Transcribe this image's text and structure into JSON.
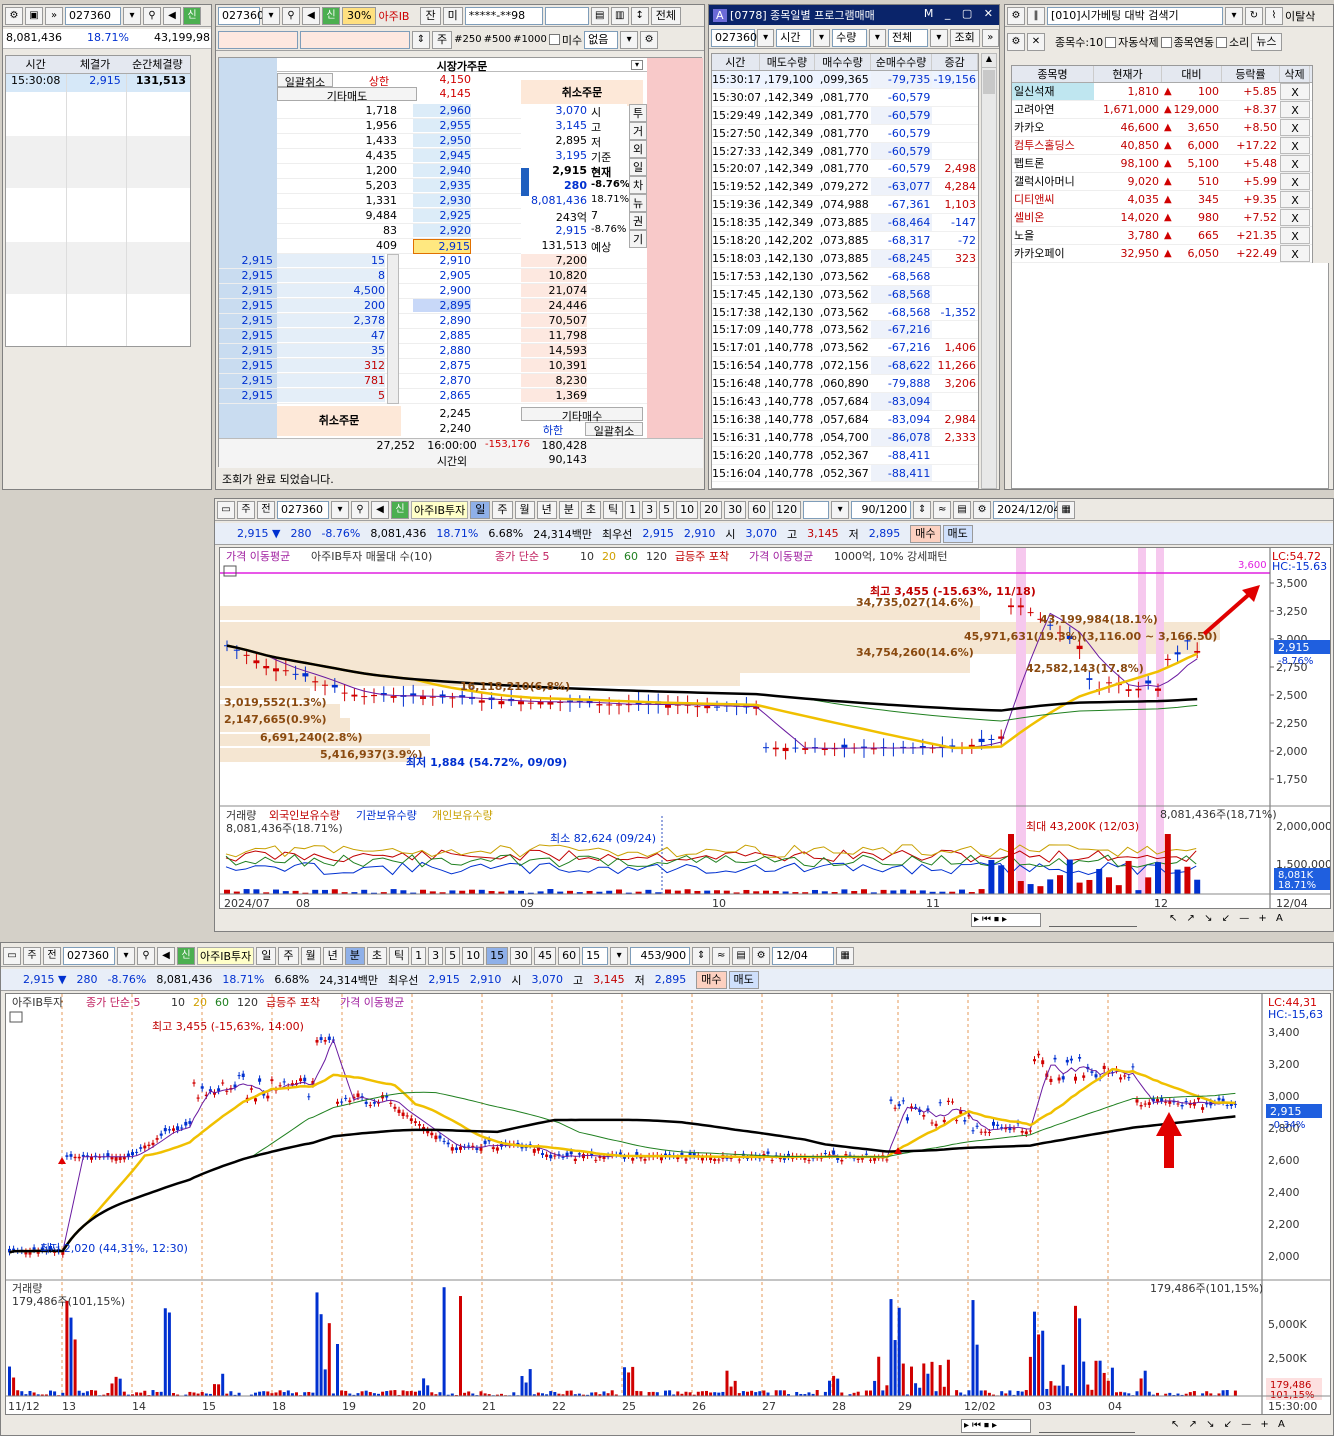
{
  "w1": {
    "code": "027360",
    "price": "8,081,436",
    "pct": "18.71%",
    "vol": "43,199,98",
    "headers": [
      "시간",
      "체결가",
      "순간체결량"
    ],
    "row": [
      "15:30:08",
      "2,915",
      "131,513"
    ]
  },
  "w2": {
    "code": "027360",
    "pct_tag": "30%",
    "name": "아주IB",
    "btn_jan": "잔",
    "btn_mi": "미",
    "acct": "*****-**98",
    "btn_all": "전체",
    "btn_ju": "주",
    "q250": "#250",
    "q500": "#500",
    "q1000": "#1000",
    "misu": "미수",
    "none": "없음",
    "title": "시장가주문",
    "cancel_all": "일괄취소",
    "upper": "상한",
    "upper_val": "4,150",
    "other_sell": "기타매도",
    "other_sell_val": "4,145",
    "cancel_order": "취소주문",
    "status": "조회가 완료 되었습니다.",
    "ask_qty": [
      "1,718",
      "1,956",
      "1,433",
      "4,435",
      "1,200",
      "5,203",
      "1,331",
      "9,484",
      "83",
      "409"
    ],
    "ask_px": [
      "2,960",
      "2,955",
      "2,950",
      "2,945",
      "2,940",
      "2,935",
      "2,930",
      "2,925",
      "2,920",
      "2,915"
    ],
    "info": [
      [
        "3,070",
        "시"
      ],
      [
        "3,145",
        "고"
      ],
      [
        "2,895",
        "저"
      ],
      [
        "3,195",
        "기준"
      ],
      [
        "2,915",
        "현재"
      ],
      [
        "280",
        "-8.76%"
      ],
      [
        "8,081,436",
        "18.71%"
      ],
      [
        "243억",
        "7"
      ],
      [
        "2,915",
        "-8.76%"
      ],
      [
        "131,513",
        "예상"
      ]
    ],
    "side_tabs": [
      "투",
      "거",
      "외",
      "일",
      "차",
      "뉴",
      "권",
      "기"
    ],
    "left_px": [
      "2,915",
      "2,915",
      "2,915",
      "2,915",
      "2,915",
      "2,915",
      "2,915",
      "2,915",
      "2,915",
      "2,915"
    ],
    "left_qty": [
      "15",
      "8",
      "4,500",
      "200",
      "2,378",
      "47",
      "35",
      "312",
      "781",
      "5"
    ],
    "bid_px": [
      "2,910",
      "2,905",
      "2,900",
      "2,895",
      "2,890",
      "2,885",
      "2,880",
      "2,875",
      "2,870",
      "2,865"
    ],
    "bid_qty": [
      "7,200",
      "10,820",
      "21,074",
      "24,446",
      "70,507",
      "11,798",
      "14,593",
      "10,391",
      "8,230",
      "1,369"
    ],
    "lower_px1": "2,245",
    "lower_px2": "2,240",
    "other_buy": "기타매수",
    "lower": "하한",
    "tot_ask": "27,252",
    "time": "16:00:00",
    "diff": "-153,176",
    "tot_bid": "180,428",
    "after": "시간외",
    "after_val": "90,143"
  },
  "w3": {
    "title": "[0778] 종목일별 프로그램매매",
    "code": "027360",
    "f1": "시간",
    "f2": "수량",
    "f3": "전체",
    "query": "조회",
    "headers": [
      "시간",
      "매도수량",
      "매수수량",
      "순매수수량",
      "증감"
    ],
    "rows": [
      [
        "15:30:17",
        ",179,100",
        ",099,365",
        "-79,735",
        "-19,156"
      ],
      [
        "15:30:07",
        ",142,349",
        ",081,770",
        "-60,579",
        ""
      ],
      [
        "15:29:49",
        ",142,349",
        ",081,770",
        "-60,579",
        ""
      ],
      [
        "15:27:50",
        ",142,349",
        ",081,770",
        "-60,579",
        ""
      ],
      [
        "15:27:33",
        ",142,349",
        ",081,770",
        "-60,579",
        ""
      ],
      [
        "15:20:07",
        ",142,349",
        ",081,770",
        "-60,579",
        "2,498"
      ],
      [
        "15:19:52",
        ",142,349",
        ",079,272",
        "-63,077",
        "4,284"
      ],
      [
        "15:19:36",
        ",142,349",
        ",074,988",
        "-67,361",
        "1,103"
      ],
      [
        "15:18:35",
        ",142,349",
        ",073,885",
        "-68,464",
        "-147"
      ],
      [
        "15:18:20",
        ",142,202",
        ",073,885",
        "-68,317",
        "-72"
      ],
      [
        "15:18:03",
        ",142,130",
        ",073,885",
        "-68,245",
        "323"
      ],
      [
        "15:17:53",
        ",142,130",
        ",073,562",
        "-68,568",
        ""
      ],
      [
        "15:17:45",
        ",142,130",
        ",073,562",
        "-68,568",
        ""
      ],
      [
        "15:17:38",
        ",142,130",
        ",073,562",
        "-68,568",
        "-1,352"
      ],
      [
        "15:17:09",
        ",140,778",
        ",073,562",
        "-67,216",
        ""
      ],
      [
        "15:17:01",
        ",140,778",
        ",073,562",
        "-67,216",
        "1,406"
      ],
      [
        "15:16:54",
        ",140,778",
        ",072,156",
        "-68,622",
        "11,266"
      ],
      [
        "15:16:48",
        ",140,778",
        ",060,890",
        "-79,888",
        "3,206"
      ],
      [
        "15:16:43",
        ",140,778",
        ",057,684",
        "-83,094",
        ""
      ],
      [
        "15:16:38",
        ",140,778",
        ",057,684",
        "-83,094",
        "2,984"
      ],
      [
        "15:16:31",
        ",140,778",
        ",054,700",
        "-86,078",
        "2,333"
      ],
      [
        "15:16:20",
        ",140,778",
        ",052,367",
        "-88,411",
        ""
      ],
      [
        "15:16:04",
        ",140,778",
        ",052,367",
        "-88,411",
        ""
      ]
    ]
  },
  "w4": {
    "title": "[010]시가베팅 대박 검색기",
    "exit": "이탈삭",
    "count": "종목수:10",
    "c1": "자동삭제",
    "c2": "종목연동",
    "c3": "소리",
    "news": "뉴스",
    "headers": [
      "종목명",
      "현재가",
      "대비",
      "등락률",
      "삭제"
    ],
    "rows": [
      [
        "일신석재",
        "1,810",
        "100",
        "+5.85",
        "X"
      ],
      [
        "고려아연",
        "1,671,000",
        "129,000",
        "+8.37",
        "X"
      ],
      [
        "카카오",
        "46,600",
        "3,650",
        "+8.50",
        "X"
      ],
      [
        "컴투스홀딩스",
        "40,850",
        "6,000",
        "+17.22",
        "X"
      ],
      [
        "펩트론",
        "98,100",
        "5,100",
        "+5.48",
        "X"
      ],
      [
        "갤럭시아머니",
        "9,020",
        "510",
        "+5.99",
        "X"
      ],
      [
        "디티앤씨",
        "4,035",
        "345",
        "+9.35",
        "X"
      ],
      [
        "셀비온",
        "14,020",
        "980",
        "+7.52",
        "X"
      ],
      [
        "노을",
        "3,780",
        "665",
        "+21.35",
        "X"
      ],
      [
        "카카오페이",
        "32,950",
        "6,050",
        "+22.49",
        "X"
      ]
    ]
  },
  "c1": {
    "code": "027360",
    "name": "아주IB투자",
    "periods": [
      "일",
      "주",
      "월",
      "년",
      "분",
      "초",
      "틱"
    ],
    "nums": [
      "1",
      "3",
      "5",
      "10",
      "20",
      "30",
      "60",
      "120"
    ],
    "count": "90/1200",
    "date": "2024/12/04",
    "quote": {
      "price": "2,915",
      "chg": "280",
      "pct": "-8.76%",
      "vol": "8,081,436",
      "vpct": "18.71%",
      "turn": "6.68%",
      "amt": "24,314백만",
      "best": "최우선",
      "ask": "2,915",
      "bid": "2,910",
      "o_l": "시",
      "o": "3,070",
      "h_l": "고",
      "h": "3,145",
      "l_l": "저",
      "l": "2,895",
      "buy": "매수",
      "sell": "매도"
    },
    "legend1": [
      "가격 이동평균",
      "아주IB투자 매물대 수(10)",
      "종가 단순 5",
      "10",
      "20",
      "60",
      "120",
      "급등주 포착",
      "가격 이동평균",
      "1000억, 10% 강세패턴"
    ],
    "annots": {
      "hi": "최고 3,455 (-15.63%, 11/18)",
      "lo": "최저 1,884 (54.72%, 09/09)",
      "lc": "LC:54.72",
      "hc": "HC:-15.63",
      "line_val": "3,600",
      "vp1": "34,735,027(14.6%)",
      "vp2": "43,199,984(18.1%)",
      "vp3": "45,971,631(19.3%)(3,116.00 ~ 3,166.50)",
      "vp4": "34,754,260(14.6%)",
      "vp5": "42,582,143(17.8%)",
      "vp6": "16,118,210(6,8%)",
      "vp7": "3,019,552(1.3%)",
      "vp8": "2,147,665(0.9%)",
      "vp9": "6,691,240(2.8%)",
      "vp10": "5,416,937(3.9%)",
      "cur": "2,915",
      "curp": "-8.76%"
    },
    "yticks": [
      "3,500",
      "3,250",
      "3,000",
      "2,750",
      "2,500",
      "2,250",
      "2,000",
      "1,750"
    ],
    "legend2": [
      "거래량",
      "외국인보유수량",
      "기관보유수량",
      "개인보유수량"
    ],
    "v_annots": {
      "left": "8,081,436주(18.71%)",
      "max": "최대 43,200K (12/03)",
      "min": "최소 82,624 (09/24)",
      "right": "8,081,436주(18,71%)",
      "vr": "8,081K",
      "vrp": "18.71%"
    },
    "vticks": [
      "2,000,000",
      "1,500,000"
    ],
    "xlabels": [
      "2024/07",
      "08",
      "09",
      "10",
      "11",
      "12",
      "12/04"
    ]
  },
  "c2": {
    "code": "027360",
    "name": "아주IB투자",
    "periods": [
      "일",
      "주",
      "월",
      "년",
      "분",
      "초",
      "틱"
    ],
    "nums": [
      "1",
      "3",
      "5",
      "10",
      "15",
      "30",
      "45",
      "60"
    ],
    "sel": "15",
    "count": "453/900",
    "date": "12/04",
    "quote": {
      "price": "2,915",
      "chg": "280",
      "pct": "-8.76%",
      "vol": "8,081,436",
      "vpct": "18.71%",
      "turn": "6.68%",
      "amt": "24,314백만",
      "best": "최우선",
      "ask": "2,915",
      "bid": "2,910",
      "o_l": "시",
      "o": "3,070",
      "h_l": "고",
      "h": "3,145",
      "l_l": "저",
      "l": "2,895",
      "buy": "매수",
      "sell": "매도"
    },
    "legend1": [
      "아주IB투자",
      "종가 단순 5",
      "10",
      "20",
      "60",
      "120",
      "급등주 포착",
      "가격 이동평균"
    ],
    "annots": {
      "hi": "최고 3,455 (-15,63%, 14:00)",
      "lo": "최저 2,020 (44,31%, 12:30)",
      "lc": "LC:44,31",
      "hc": "HC:-15,63",
      "cur": "2,915",
      "curp": "-0.34%"
    },
    "yticks": [
      "3,400",
      "3,200",
      "3,000",
      "2,800",
      "2,600",
      "2,400",
      "2,200",
      "2,000"
    ],
    "legend2": [
      "거래량"
    ],
    "v_annots": {
      "left": "179,486주(101,15%)",
      "right": "179,486주(101,15%)",
      "vr": "179,486",
      "vrp": "101,15%"
    },
    "vticks": [
      "5,000K",
      "2,500K"
    ],
    "xlabels": [
      "11/12",
      "13",
      "14",
      "15",
      "18",
      "19",
      "20",
      "21",
      "22",
      "25",
      "26",
      "27",
      "28",
      "29",
      "12/02",
      "03",
      "04"
    ],
    "xright": "15:30:00"
  }
}
